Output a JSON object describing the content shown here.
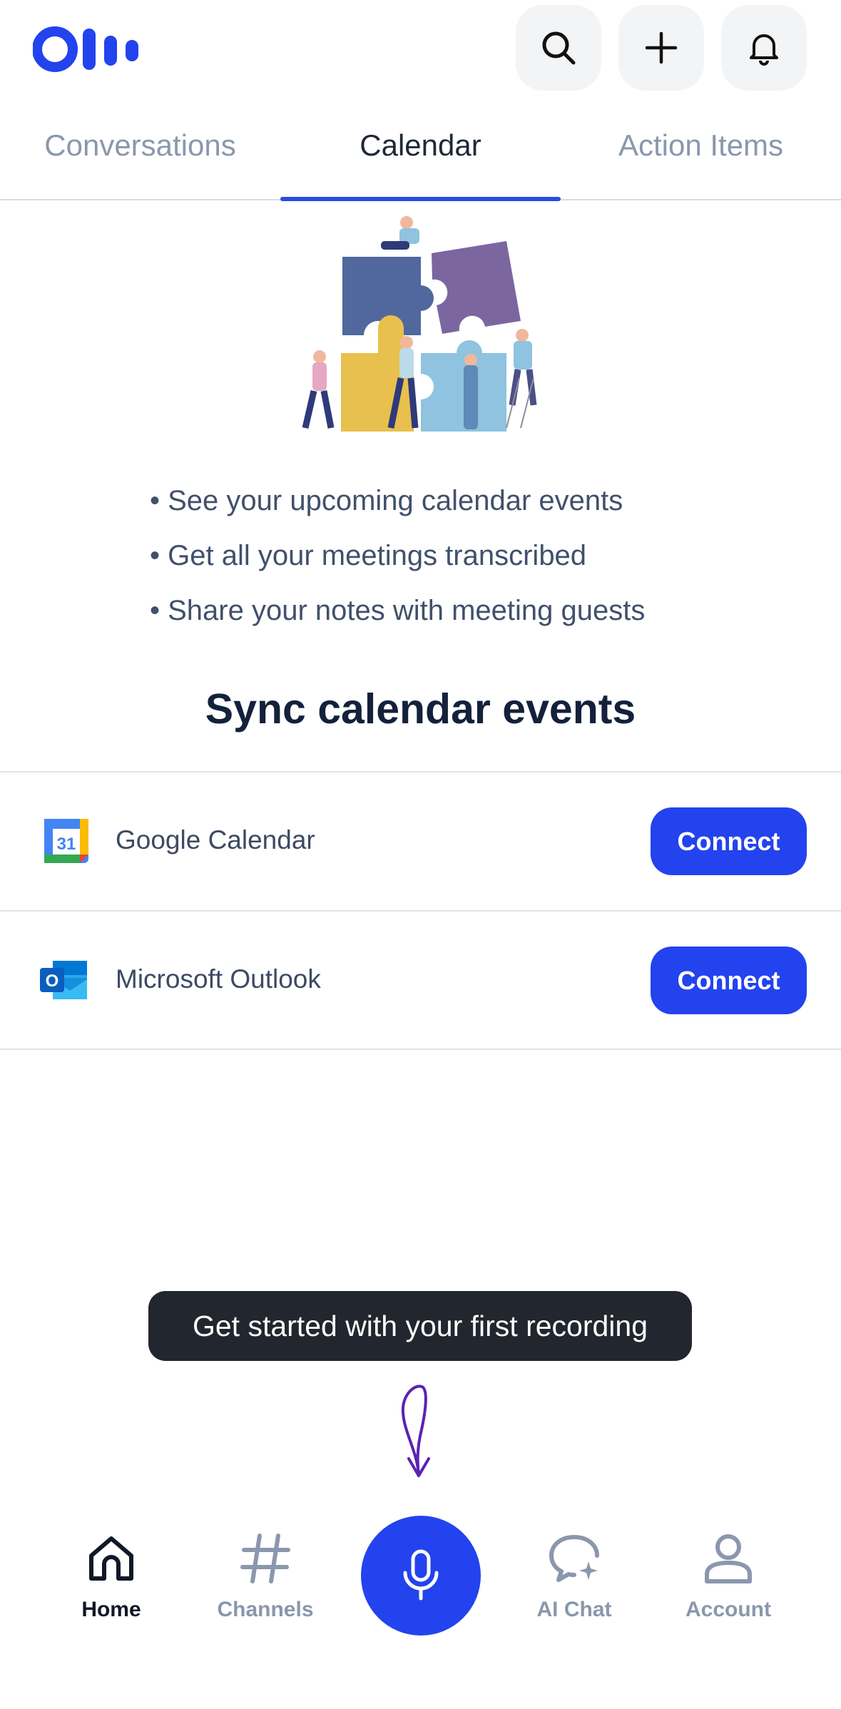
{
  "header": {
    "logo_name": "otter-logo",
    "actions": [
      {
        "icon": "search-icon"
      },
      {
        "icon": "plus-icon"
      },
      {
        "icon": "bell-icon"
      }
    ]
  },
  "tabs": [
    {
      "label": "Conversations",
      "active": false
    },
    {
      "label": "Calendar",
      "active": true
    },
    {
      "label": "Action Items",
      "active": false
    }
  ],
  "benefits": [
    "• See your upcoming calendar events",
    "• Get all your meetings transcribed",
    "• Share your notes with meeting guests"
  ],
  "sync": {
    "title": "Sync calendar events",
    "providers": [
      {
        "name": "Google Calendar",
        "icon_text": "31",
        "button": "Connect"
      },
      {
        "name": "Microsoft Outlook",
        "icon_text": "O",
        "button": "Connect"
      }
    ]
  },
  "tooltip": "Get started with your first recording",
  "bottom_nav": [
    {
      "label": "Home",
      "icon": "home-icon",
      "active": true
    },
    {
      "label": "Channels",
      "icon": "hash-icon",
      "active": false
    },
    {
      "label": "AI Chat",
      "icon": "ai-chat-icon",
      "active": false
    },
    {
      "label": "Account",
      "icon": "account-icon",
      "active": false
    }
  ],
  "colors": {
    "accent": "#2343ee",
    "tab_indicator": "#2a4cdc",
    "tooltip_bg": "#22262e",
    "arrow": "#5b21b6"
  }
}
